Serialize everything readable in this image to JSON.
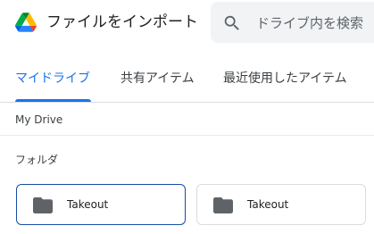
{
  "header": {
    "logo_icon": "google-drive-logo-icon",
    "title": "ファイルをインポート",
    "search": {
      "icon": "search-icon",
      "placeholder": "ドライブ内を検索"
    }
  },
  "tabs": [
    {
      "label": "マイドライブ",
      "active": true
    },
    {
      "label": "共有アイテム",
      "active": false
    },
    {
      "label": "最近使用したアイテム",
      "active": false
    }
  ],
  "breadcrumb": "My Drive",
  "section": {
    "label": "フォルダ",
    "folders": [
      {
        "name": "Takeout",
        "icon": "folder-icon",
        "selected": true
      },
      {
        "name": "Takeout",
        "icon": "folder-icon",
        "selected": false
      }
    ]
  },
  "colors": {
    "accent": "#1a73e8",
    "selected_border": "#174ea6",
    "search_bg": "#f1f3f4",
    "folder_icon": "#5f6368"
  }
}
